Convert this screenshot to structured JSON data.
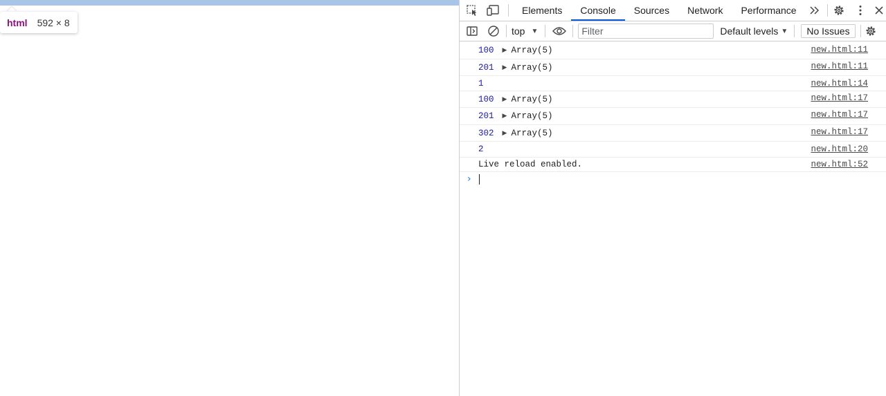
{
  "page": {
    "tooltip": {
      "tag": "html",
      "dims": "592 × 8"
    }
  },
  "devtools": {
    "tabs": [
      {
        "label": "Elements"
      },
      {
        "label": "Console",
        "active": true
      },
      {
        "label": "Sources"
      },
      {
        "label": "Network"
      },
      {
        "label": "Performance"
      }
    ],
    "toolbar": {
      "context": "top",
      "filter_placeholder": "Filter",
      "levels": "Default levels",
      "issues": "No Issues"
    },
    "console": {
      "rows": [
        {
          "a": "10",
          "b": "0",
          "array": "Array(5)",
          "src": "new.html:11"
        },
        {
          "a": "20",
          "b": "1",
          "array": "Array(5)",
          "src": "new.html:11"
        },
        {
          "a": "1",
          "src": "new.html:14"
        },
        {
          "a": "10",
          "b": "0",
          "array": "Array(5)",
          "src": "new.html:17"
        },
        {
          "a": "20",
          "b": "1",
          "array": "Array(5)",
          "src": "new.html:17"
        },
        {
          "a": "30",
          "b": "2",
          "array": "Array(5)",
          "src": "new.html:17"
        },
        {
          "a": "2",
          "src": "new.html:20"
        },
        {
          "text": "Live reload enabled.",
          "src": "new.html:52"
        }
      ]
    },
    "colors": {
      "accent": "#0b57d0",
      "number": "#1a1aa6",
      "highlight": "#a8c4e6"
    },
    "icons": [
      "select-element-icon",
      "device-toolbar-icon",
      "more-tabs-icon",
      "settings-icon",
      "kebab-menu-icon",
      "close-icon",
      "sidebar-toggle-icon",
      "clear-console-icon",
      "live-expression-eye-icon",
      "console-settings-icon",
      "prompt-chevron-icon"
    ]
  }
}
